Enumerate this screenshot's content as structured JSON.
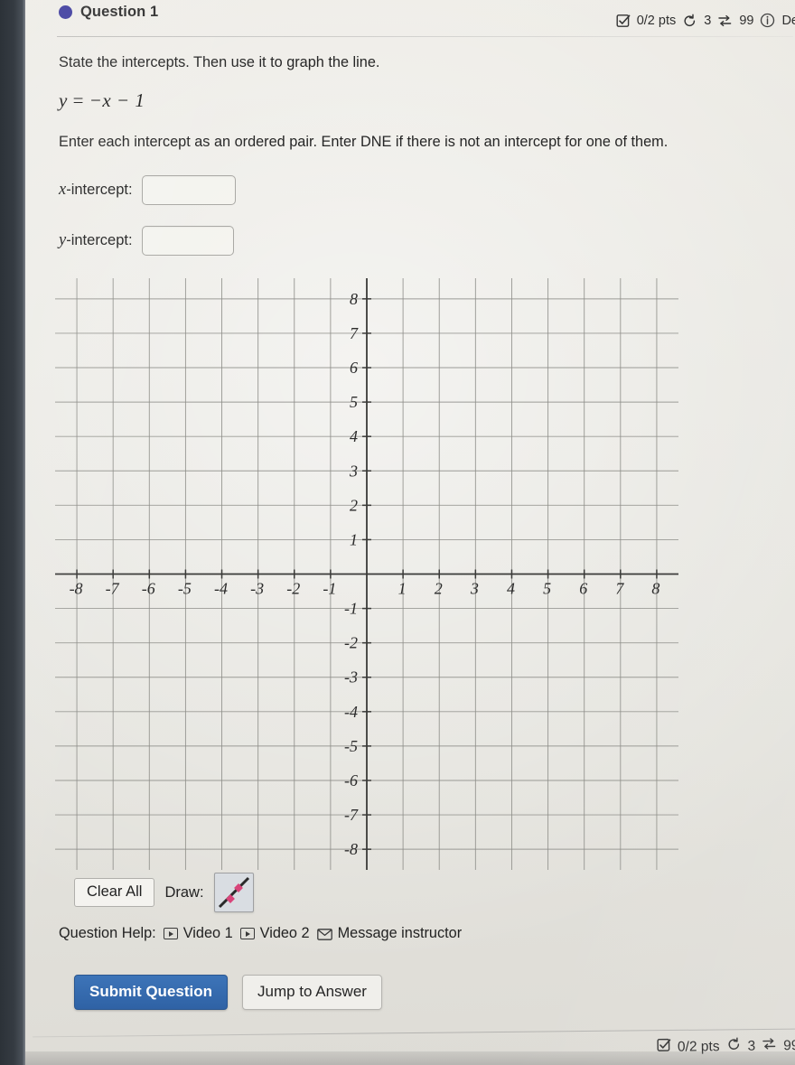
{
  "header": {
    "question_label": "Question 1",
    "status_dot_color": "#3f3d9e",
    "score": "0/2 pts",
    "attempts_icon": "retry-icon",
    "attempts": "3",
    "versions_icon": "shuffle-icon",
    "versions": "99",
    "details_icon": "info-icon",
    "details_label": "De"
  },
  "body": {
    "prompt": "State the intercepts. Then use it to graph the line.",
    "equation": "y = -x - 1",
    "equation_parts": {
      "lhs": "y",
      "eq": "=",
      "rhs": "−x − 1"
    },
    "subprompt": "Enter each intercept as an ordered pair. Enter DNE if there is not an intercept for one of them.",
    "x_intercept_label_var": "x",
    "x_intercept_label_rest": "-intercept:",
    "x_intercept_value": "",
    "x_intercept_placeholder": "",
    "y_intercept_label_var": "y",
    "y_intercept_label_rest": "-intercept:",
    "y_intercept_value": "",
    "y_intercept_placeholder": ""
  },
  "chart_data": {
    "type": "scatter",
    "title": "",
    "xlabel": "",
    "ylabel": "",
    "xlim": [
      -8.6,
      8.6
    ],
    "ylim": [
      -8.6,
      8.6
    ],
    "xticks": [
      -8,
      -7,
      -6,
      -5,
      -4,
      -3,
      -2,
      -1,
      1,
      2,
      3,
      4,
      5,
      6,
      7,
      8
    ],
    "yticks": [
      8,
      7,
      6,
      5,
      4,
      3,
      2,
      1,
      -1,
      -2,
      -3,
      -4,
      -5,
      -6,
      -7,
      -8
    ],
    "xtick_labels": [
      "-8",
      "-7",
      "-6",
      "-5",
      "-4",
      "-3",
      "-2",
      "-1",
      "1",
      "2",
      "3",
      "4",
      "5",
      "6",
      "7",
      "8"
    ],
    "ytick_labels": [
      "8",
      "7",
      "6",
      "5",
      "4",
      "3",
      "2",
      "1",
      "-1",
      "-2",
      "-3",
      "-4",
      "-5",
      "-6",
      "-7",
      "-8"
    ],
    "grid": true,
    "grid_step": 1,
    "legend": false,
    "series": [
      {
        "name": "user-plot",
        "values": []
      }
    ],
    "annotations": []
  },
  "draw_toolbar": {
    "clear_all_label": "Clear All",
    "draw_label": "Draw:",
    "tool_icon": "line-segment-tool-icon",
    "tool_point_color": "#d9447a",
    "tool_line_color": "#2a2a2a"
  },
  "help": {
    "label": "Question Help:",
    "items": [
      {
        "icon": "video-icon",
        "label": "Video 1"
      },
      {
        "icon": "video-icon",
        "label": "Video 2"
      },
      {
        "icon": "envelope-icon",
        "label": "Message instructor"
      }
    ]
  },
  "actions": {
    "submit_label": "Submit Question",
    "submit_color": "#2f62a5",
    "jump_label": "Jump to Answer"
  },
  "next_question": {
    "score": "0/2 pts",
    "attempts": "3",
    "versions": "99"
  }
}
